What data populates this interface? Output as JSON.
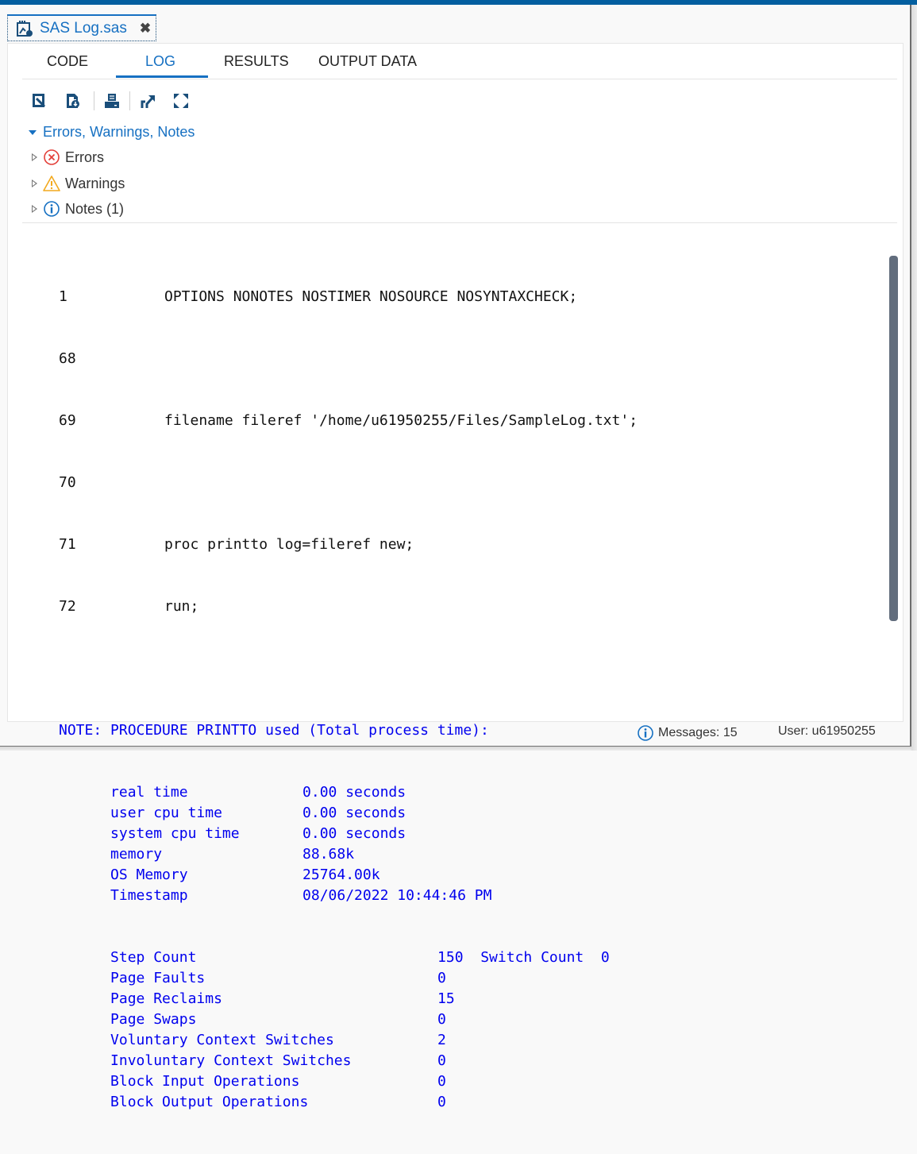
{
  "file_tab": {
    "name": "SAS Log.sas",
    "icon": "sas-log-file-icon",
    "close_glyph": "✖"
  },
  "tabs": [
    {
      "label": "CODE",
      "active": false
    },
    {
      "label": "LOG",
      "active": true
    },
    {
      "label": "RESULTS",
      "active": false
    },
    {
      "label": "OUTPUT DATA",
      "active": false
    }
  ],
  "toolbar": {
    "buttons": [
      {
        "name": "save-log-icon",
        "tooltip": ""
      },
      {
        "name": "download-log-icon",
        "tooltip": ""
      },
      {
        "name": "print-icon",
        "tooltip": ""
      },
      {
        "name": "popout-icon",
        "tooltip": ""
      },
      {
        "name": "maximize-icon",
        "tooltip": ""
      }
    ]
  },
  "messages_panel": {
    "header": "Errors, Warnings, Notes",
    "items": [
      {
        "label": "Errors",
        "icon": "error-icon",
        "color": "#e3403a"
      },
      {
        "label": "Warnings",
        "icon": "warning-icon",
        "color": "#f2a91f"
      },
      {
        "label": "Notes (1)",
        "icon": "info-icon",
        "color": "#1670c2"
      }
    ]
  },
  "log": {
    "source_lines": [
      {
        "num": "1",
        "code": "OPTIONS NONOTES NOSTIMER NOSOURCE NOSYNTAXCHECK;"
      },
      {
        "num": "68",
        "code": ""
      },
      {
        "num": "69",
        "code": "filename fileref '/home/u61950255/Files/SampleLog.txt';"
      },
      {
        "num": "70",
        "code": ""
      },
      {
        "num": "71",
        "code": "proc printto log=fileref new;"
      },
      {
        "num": "72",
        "code": "run;"
      }
    ],
    "note_header": "NOTE: PROCEDURE PRINTTO used (Total process time):",
    "stats": [
      {
        "label": "real time",
        "value": "0.00 seconds"
      },
      {
        "label": "user cpu time",
        "value": "0.00 seconds"
      },
      {
        "label": "system cpu time",
        "value": "0.00 seconds"
      },
      {
        "label": "memory",
        "value": "88.68k"
      },
      {
        "label": "OS Memory",
        "value": "25764.00k"
      },
      {
        "label": "Timestamp",
        "value": "08/06/2022 10:44:46 PM"
      }
    ],
    "counters": [
      {
        "label": "Step Count",
        "value": "150  Switch Count  0"
      },
      {
        "label": "Page Faults",
        "value": "0"
      },
      {
        "label": "Page Reclaims",
        "value": "15"
      },
      {
        "label": "Page Swaps",
        "value": "0"
      },
      {
        "label": "Voluntary Context Switches",
        "value": "2"
      },
      {
        "label": "Involuntary Context Switches",
        "value": "0"
      },
      {
        "label": "Block Input Operations",
        "value": "0"
      },
      {
        "label": "Block Output Operations",
        "value": "0"
      }
    ],
    "note_color": "#0000ee"
  },
  "status_bar": {
    "messages": "Messages: 15",
    "user": "User: u61950255"
  },
  "colors": {
    "accent": "#1670c2",
    "topbar": "#035fa0",
    "scrollbar": "#626d7d"
  }
}
